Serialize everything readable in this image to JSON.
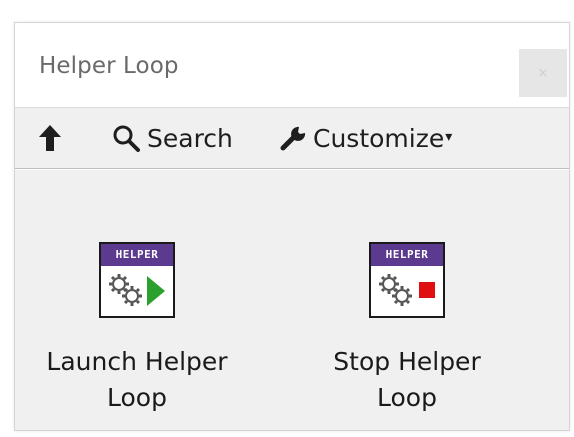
{
  "window": {
    "title": "Helper Loop",
    "close_glyph": "×"
  },
  "toolbar": {
    "up_icon": "up-arrow-icon",
    "search_label": "Search",
    "customize_label": "Customize",
    "customize_caret": "▾"
  },
  "palette_items": [
    {
      "banner": "HELPER",
      "label_line1": "Launch Helper",
      "label_line2": "Loop",
      "glyph": "gears-play-icon",
      "accent_color": "#2ca02c"
    },
    {
      "banner": "HELPER",
      "label_line1": "Stop Helper",
      "label_line2": "Loop",
      "glyph": "gears-stop-icon",
      "accent_color": "#e01010"
    }
  ],
  "colors": {
    "banner": "#5b3a8f",
    "panel": "#f0f0f0"
  }
}
